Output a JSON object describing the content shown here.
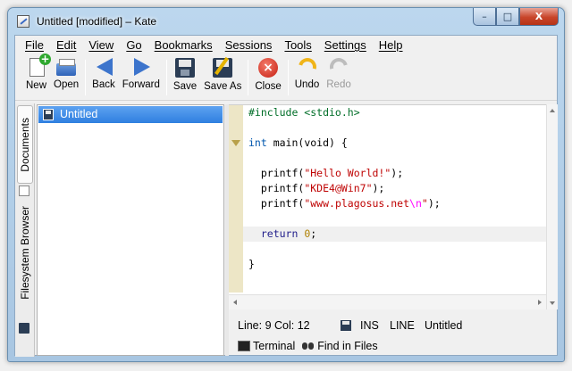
{
  "window": {
    "title": "Untitled [modified] – Kate",
    "controls": {
      "minimize": "–",
      "maximize": "□",
      "close": "X"
    }
  },
  "menubar": [
    "File",
    "Edit",
    "View",
    "Go",
    "Bookmarks",
    "Sessions",
    "Tools",
    "Settings",
    "Help"
  ],
  "toolbar": {
    "new": "New",
    "open": "Open",
    "back": "Back",
    "forward": "Forward",
    "save": "Save",
    "save_as": "Save As",
    "close": "Close",
    "undo": "Undo",
    "redo": "Redo"
  },
  "sidebar": {
    "documents_tab": "Documents",
    "filesystem_tab": "Filesystem Browser",
    "documents": [
      "Untitled"
    ]
  },
  "editor": {
    "lines": [
      "#include <stdio.h>",
      "",
      "int main(void) {",
      "",
      "  printf(\"Hello World!\");",
      "  printf(\"KDE4@Win7\");",
      "  printf(\"www.plagosus.net\\n\");",
      "",
      "  return 0;",
      "",
      "}"
    ],
    "tokens": {
      "include": "#include <stdio.h>",
      "int": "int",
      "main_sig": " main(void) {",
      "printf": "printf(",
      "str1": "\"Hello World!\"",
      "str2": "\"KDE4@Win7\"",
      "str3a": "\"www.plagosus.net",
      "str3b": "\\n",
      "str3c": "\"",
      "close_call": ");",
      "return": "return",
      "zero": "0",
      "semicolon": ";",
      "brace": "}"
    },
    "current_line": 9
  },
  "status": {
    "position": "Line: 9 Col: 12",
    "mode": "INS",
    "selection": "LINE",
    "document": "Untitled"
  },
  "toolviews": {
    "terminal": "Terminal",
    "find_in_files": "Find in Files"
  }
}
